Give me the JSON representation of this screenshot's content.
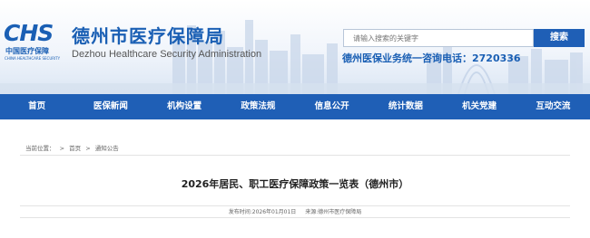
{
  "header": {
    "logo_mark": "CHS",
    "logo_cn": "中国医疗保障",
    "logo_en": "CHINA HEALTHCARE SECURITY",
    "title": "德州市医疗保障局",
    "subtitle": "Dezhou Healthcare Security Administration"
  },
  "search": {
    "placeholder": "请输入搜索的关键字",
    "button_label": "搜索"
  },
  "hotline": {
    "label": "德州医保业务统一咨询电话：",
    "number": "2720336"
  },
  "nav": {
    "items": [
      {
        "label": "首页"
      },
      {
        "label": "医保新闻"
      },
      {
        "label": "机构设置"
      },
      {
        "label": "政策法规"
      },
      {
        "label": "信息公开"
      },
      {
        "label": "统计数据"
      },
      {
        "label": "机关党建"
      },
      {
        "label": "互动交流"
      }
    ]
  },
  "breadcrumb": {
    "prefix": "当前位置：",
    "items": [
      "首页",
      "通知公告"
    ],
    "separator": ">"
  },
  "article": {
    "title": "2026年居民、职工医疗保障政策一览表（德州市）",
    "publish_time": "发布时间:2026年01月01日",
    "source": "来源:德州市医疗保障局"
  },
  "colors": {
    "brand_blue": "#1a5fb4",
    "nav_blue": "#1f5fb6"
  }
}
